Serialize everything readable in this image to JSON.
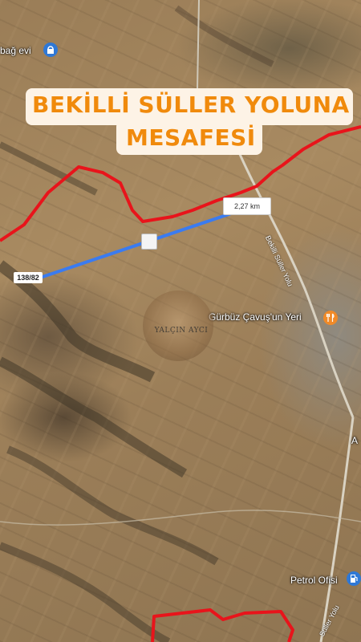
{
  "title": {
    "line1": "BEKİLLİ SÜLLER YOLUNA",
    "line2": "MESAFESİ"
  },
  "measurement": {
    "distance_label": "2,27 km",
    "line_color": "#3a7bf0"
  },
  "parcel": {
    "label": "138/82"
  },
  "places": {
    "top_left": "bağ evi",
    "restaurant": "Gürbüz Çavuş'un Yeri",
    "gas_station": "Petrol Ofisi"
  },
  "roads": {
    "upper": "Bekilli Süller Yolu",
    "lower": "Süller Yolu",
    "edge_fragment": "A"
  },
  "watermark": {
    "text": "YALÇIN AYCI"
  },
  "colors": {
    "boundary": "#e8141b",
    "title_text": "#f08a0c",
    "title_bg": "#fdf3e6",
    "poi_blue": "#2f78d6",
    "poi_orange": "#f08a28"
  },
  "icons": {
    "top_left": "lodging-icon",
    "restaurant": "restaurant-icon",
    "gas_station": "gas-station-icon"
  }
}
